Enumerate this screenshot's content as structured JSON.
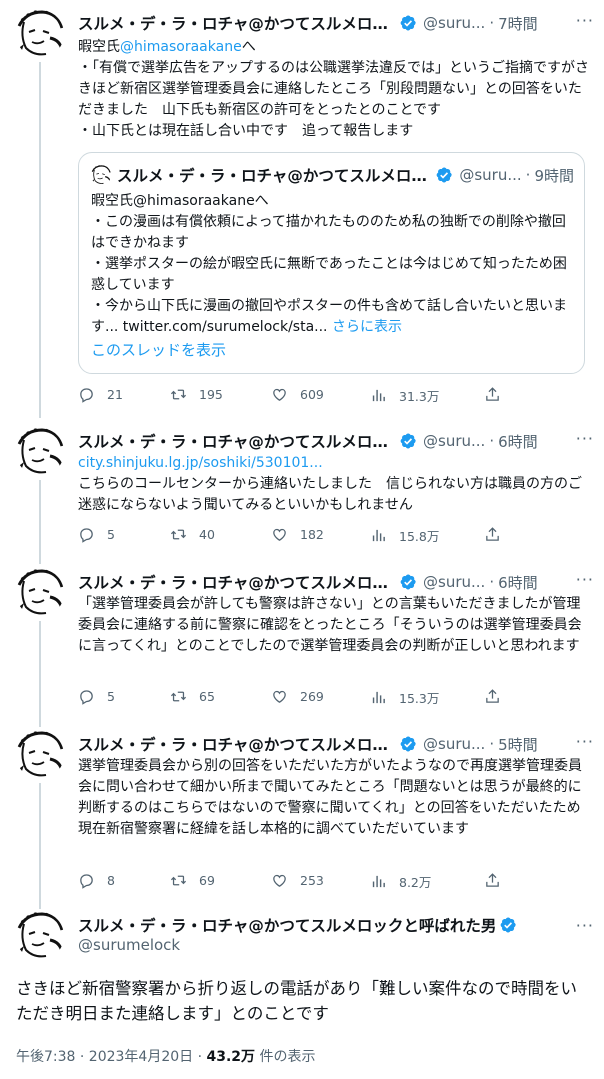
{
  "author": {
    "name": "スルメ・デ・ラ・ロチャ@かつてスルメロックと呼ばれた男",
    "name_truncated": "スルメ・デ・ラ・ロチャ@かつてスルメロッ...",
    "handle_short": "@suru...",
    "handle_full": "@surumelock"
  },
  "colors": {
    "accent": "#1d9bf0",
    "verified": "#1d9bf0",
    "muted": "#536471",
    "border": "#cfd9de"
  },
  "tweets": [
    {
      "time": "7時間",
      "line1_prefix": "暇空氏",
      "line1_mention": "@himasoraakane",
      "line1_suffix": "へ",
      "text": "・「有償で選挙広告をアップするのは公職選挙法違反では」というご指摘ですがさきほど新宿区選挙管理委員会に連絡したところ「別段問題ない」との回答をいただきました　山下氏も新宿区の許可をとったとのことです\n・山下氏とは現在話し合い中です　追って報告します",
      "quote": {
        "time": "9時間",
        "text": "暇空氏@himasoraakaneへ\n・この漫画は有償依頼によって描かれたもののため私の独断での削除や撤回はできかねます\n・選挙ポスターの絵が暇空氏に無断であったことは今はじめて知ったため困惑しています\n・今から山下氏に漫画の撤回やポスターの件も含めて話し合いたいと思います... twitter.com/surumelock/sta...",
        "show_more": "さらに表示",
        "show_thread": "このスレッドを表示"
      },
      "stats": {
        "replies": "21",
        "retweets": "195",
        "likes": "609",
        "views": "31.3万"
      }
    },
    {
      "time": "6時間",
      "link": "city.shinjuku.lg.jp/soshiki/530101...",
      "text": "こちらのコールセンターから連絡いたしました　信じられない方は職員の方のご迷惑にならないよう聞いてみるといいかもしれません",
      "stats": {
        "replies": "5",
        "retweets": "40",
        "likes": "182",
        "views": "15.8万"
      }
    },
    {
      "time": "6時間",
      "text": "「選挙管理委員会が許しても警察は許さない」との言葉もいただきましたが管理委員会に連絡する前に警察に確認をとったところ「そういうのは選挙管理委員会に言ってくれ」とのことでしたので選挙管理委員会の判断が正しいと思われます",
      "stats": {
        "replies": "5",
        "retweets": "65",
        "likes": "269",
        "views": "15.3万"
      }
    },
    {
      "time": "5時間",
      "text": "選挙管理委員会から別の回答をいただいた方がいたようなので再度選挙管理委員会に問い合わせて細かい所まで聞いてみたところ「問題ないとは思うが最終的に判断するのはこちらではないので警察に聞いてくれ」との回答をいただいたため現在新宿警察署に経緯を話し本格的に調べていただいています",
      "stats": {
        "replies": "8",
        "retweets": "69",
        "likes": "253",
        "views": "8.2万"
      }
    }
  ],
  "main": {
    "text": "さきほど新宿警察署から折り返しの電話があり「難しい案件なので時間をいただき明日また連絡します」とのことです",
    "date": "午後7:38 · 2023年4月20日 · ",
    "views_count": "43.2万",
    "views_label": " 件の表示"
  },
  "icons": [
    "reply-icon",
    "retweet-icon",
    "like-icon",
    "views-icon",
    "share-icon",
    "verified-icon",
    "more-icon"
  ]
}
